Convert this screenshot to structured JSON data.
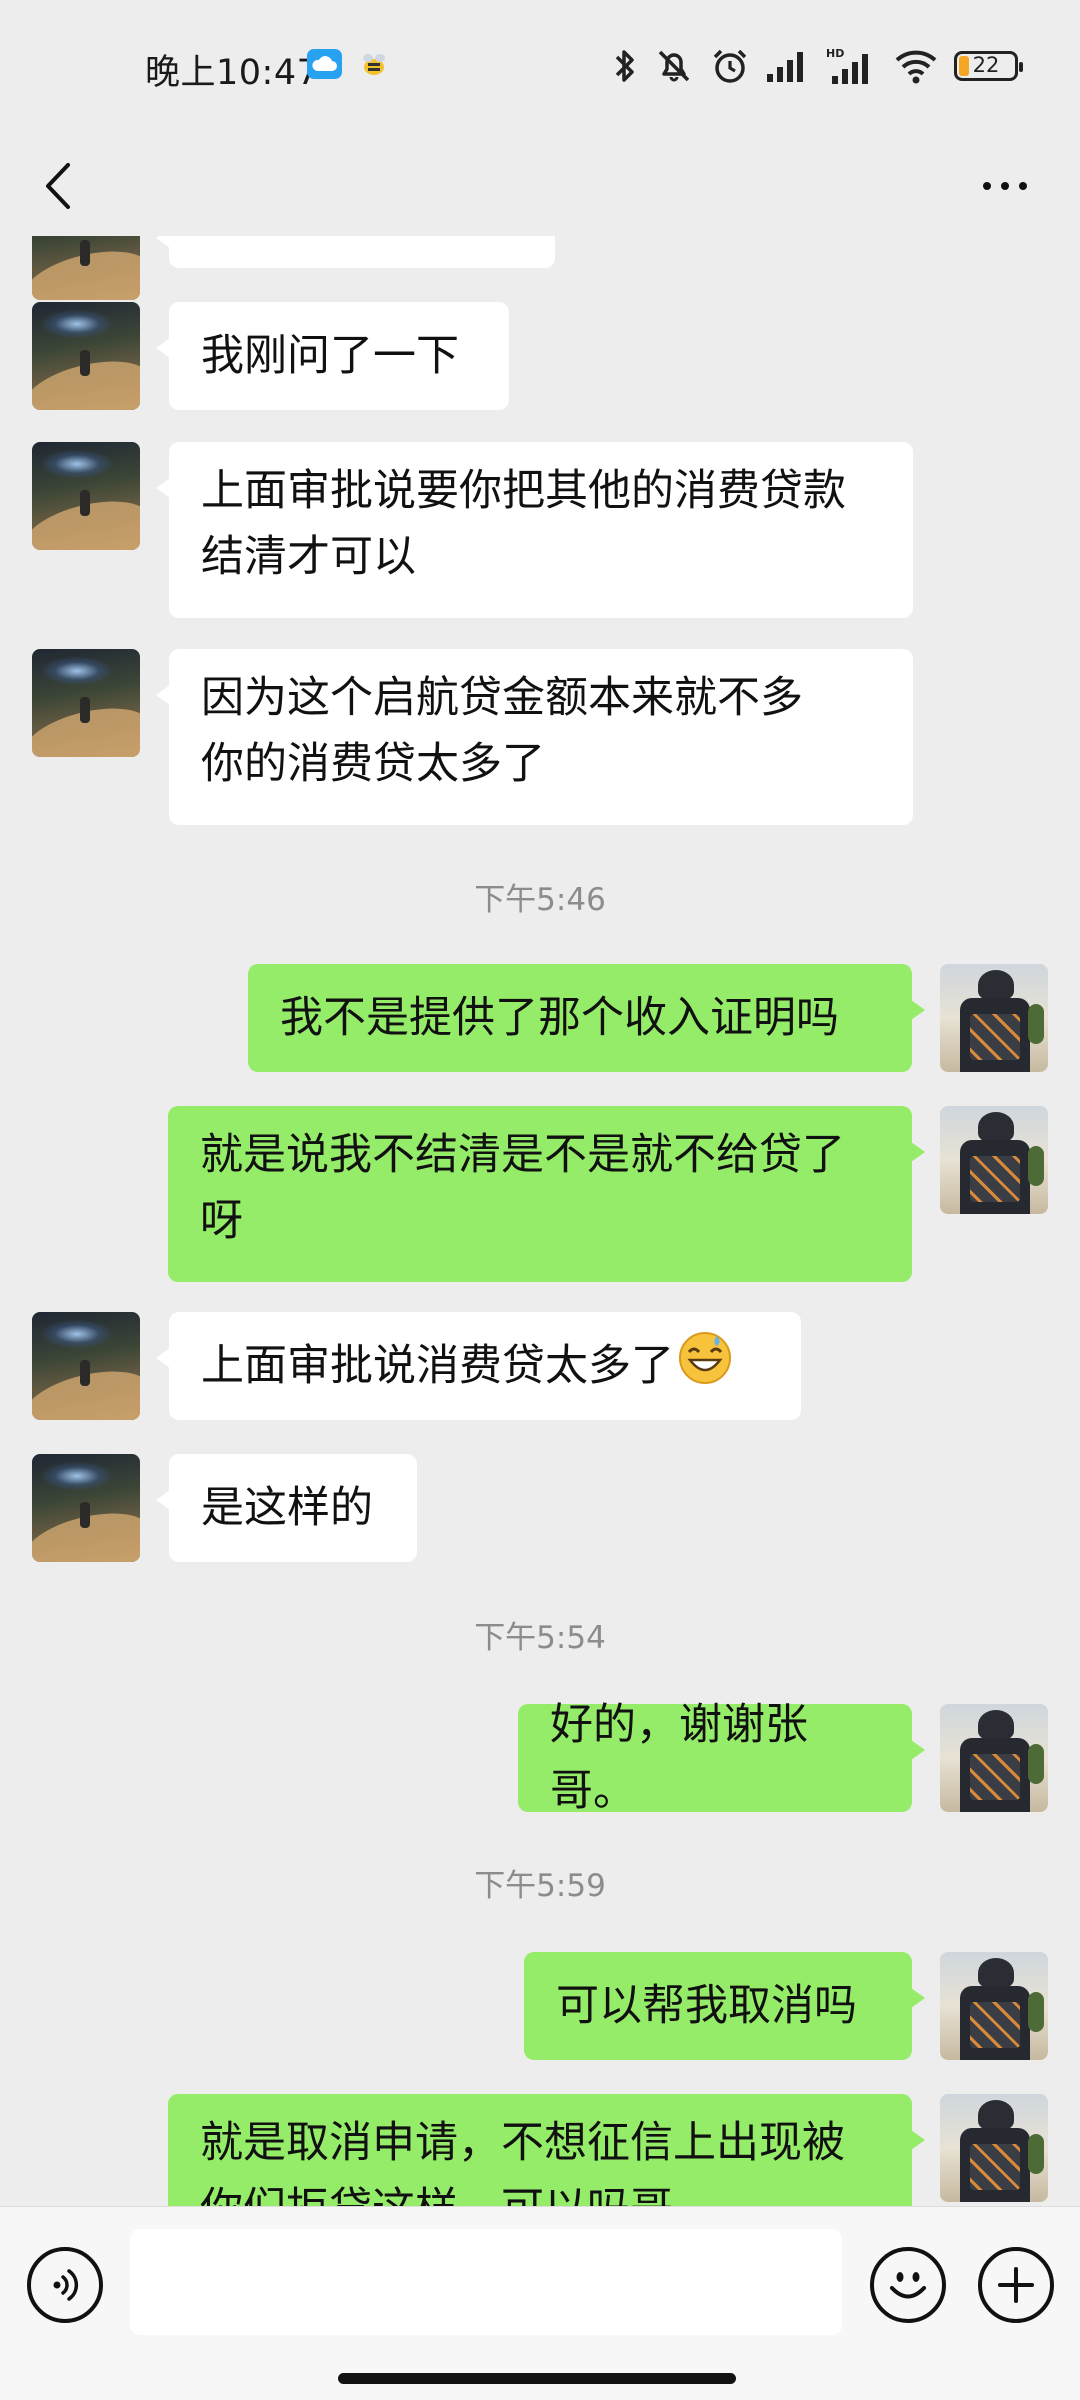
{
  "status_bar": {
    "time": "晚上10:47",
    "battery_level": "22",
    "icons": [
      "cloud-icon",
      "bee-app-icon",
      "bluetooth-icon",
      "mute-icon",
      "alarm-icon",
      "signal-icon",
      "hd-signal-icon",
      "wifi-icon",
      "battery-icon"
    ]
  },
  "nav": {
    "back_icon": "chevron-left-icon",
    "more_icon": "more-icon"
  },
  "messages": [
    {
      "from": "peer",
      "text": "我刚问了一下"
    },
    {
      "from": "peer",
      "lines": [
        "上面审批说要你把其他的消费贷款",
        "结清才可以"
      ]
    },
    {
      "from": "peer",
      "lines": [
        "因为这个启航贷金额本来就不多",
        "你的消费贷太多了"
      ]
    },
    {
      "time": "下午5:46"
    },
    {
      "from": "me",
      "text": "我不是提供了那个收入证明吗"
    },
    {
      "from": "me",
      "lines": [
        "就是说我不结清是不是就不给贷了",
        "呀"
      ]
    },
    {
      "from": "peer",
      "text": "上面审批说消费贷太多了",
      "emoji": "grinning-sweat-emoji"
    },
    {
      "from": "peer",
      "text": "是这样的"
    },
    {
      "time": "下午5:54"
    },
    {
      "from": "me",
      "text": "好的，谢谢张哥。"
    },
    {
      "time": "下午5:59"
    },
    {
      "from": "me",
      "text": "可以帮我取消吗"
    },
    {
      "from": "me",
      "lines": [
        "就是取消申请，不想征信上出现被",
        "你们拒贷这样，可以吗哥"
      ]
    }
  ],
  "input_bar": {
    "voice_icon": "voice-icon",
    "input_value": "",
    "emoji_icon": "emoji-icon",
    "plus_icon": "plus-icon"
  },
  "colors": {
    "background": "#ededed",
    "bubble_me": "#95ec69",
    "bubble_peer": "#ffffff",
    "timestamp": "#8c8c8c"
  }
}
